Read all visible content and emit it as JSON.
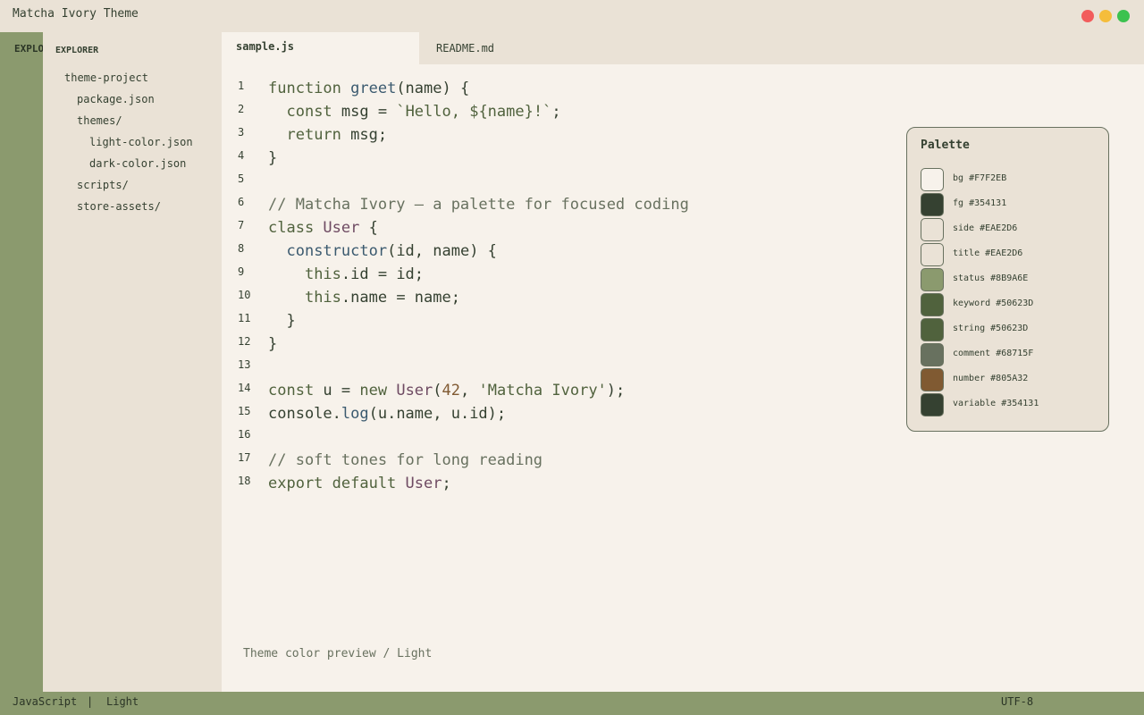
{
  "app": {
    "title": "Matcha Ivory Theme",
    "window_controls": [
      {
        "name": "close",
        "color": "#F25C5C"
      },
      {
        "name": "minimize",
        "color": "#F5BD3B"
      },
      {
        "name": "maximize",
        "color": "#3CC24F"
      }
    ]
  },
  "activity_bar": {
    "label": "EXPLORER"
  },
  "sidebar": {
    "header": "EXPLORER",
    "tree": [
      {
        "label": "theme-project",
        "depth": 0
      },
      {
        "label": "package.json",
        "depth": 1
      },
      {
        "label": "themes/",
        "depth": 1
      },
      {
        "label": "light-color.json",
        "depth": 2
      },
      {
        "label": "dark-color.json",
        "depth": 2
      },
      {
        "label": "scripts/",
        "depth": 1
      },
      {
        "label": "store-assets/",
        "depth": 1
      }
    ]
  },
  "tabs": [
    {
      "label": "sample.js",
      "active": true
    },
    {
      "label": "README.md",
      "active": false
    }
  ],
  "editor": {
    "lines": [
      [
        [
          "keyword",
          "function "
        ],
        [
          "fn",
          "greet"
        ],
        [
          "plain",
          "(name) {"
        ]
      ],
      [
        [
          "plain",
          "  "
        ],
        [
          "keyword",
          "const"
        ],
        [
          "plain",
          " msg = "
        ],
        [
          "string",
          "`Hello, ${name}!`"
        ],
        [
          "plain",
          ";"
        ]
      ],
      [
        [
          "plain",
          "  "
        ],
        [
          "keyword",
          "return"
        ],
        [
          "plain",
          " msg;"
        ]
      ],
      [
        [
          "plain",
          "}"
        ]
      ],
      [],
      [
        [
          "comment",
          "// Matcha Ivory — a palette for focused coding"
        ]
      ],
      [
        [
          "keyword",
          "class "
        ],
        [
          "class",
          "User"
        ],
        [
          "plain",
          " {"
        ]
      ],
      [
        [
          "plain",
          "  "
        ],
        [
          "fn",
          "constructor"
        ],
        [
          "plain",
          "(id, name) {"
        ]
      ],
      [
        [
          "plain",
          "    "
        ],
        [
          "keyword",
          "this"
        ],
        [
          "plain",
          ".id = id;"
        ]
      ],
      [
        [
          "plain",
          "    "
        ],
        [
          "keyword",
          "this"
        ],
        [
          "plain",
          ".name = name;"
        ]
      ],
      [
        [
          "plain",
          "  }"
        ]
      ],
      [
        [
          "plain",
          "}"
        ]
      ],
      [],
      [
        [
          "keyword",
          "const"
        ],
        [
          "plain",
          " u = "
        ],
        [
          "keyword",
          "new "
        ],
        [
          "class",
          "User"
        ],
        [
          "plain",
          "("
        ],
        [
          "number",
          "42"
        ],
        [
          "plain",
          ", "
        ],
        [
          "string",
          "'Matcha Ivory'"
        ],
        [
          "plain",
          ");"
        ]
      ],
      [
        [
          "plain",
          "console."
        ],
        [
          "fn",
          "log"
        ],
        [
          "plain",
          "(u.name, u.id);"
        ]
      ],
      [],
      [
        [
          "comment",
          "// soft tones for long reading"
        ]
      ],
      [
        [
          "keyword",
          "export default "
        ],
        [
          "class",
          "User"
        ],
        [
          "plain",
          ";"
        ]
      ]
    ],
    "footnote": "Theme color preview / Light"
  },
  "palette": {
    "title": "Palette",
    "entries": [
      {
        "name": "bg",
        "hex": "#F7F2EB"
      },
      {
        "name": "fg",
        "hex": "#354131"
      },
      {
        "name": "side",
        "hex": "#EAE2D6"
      },
      {
        "name": "title",
        "hex": "#EAE2D6"
      },
      {
        "name": "status",
        "hex": "#8B9A6E"
      },
      {
        "name": "keyword",
        "hex": "#50623D"
      },
      {
        "name": "string",
        "hex": "#50623D"
      },
      {
        "name": "comment",
        "hex": "#68715F"
      },
      {
        "name": "number",
        "hex": "#805A32"
      },
      {
        "name": "variable",
        "hex": "#354131"
      }
    ]
  },
  "status_bar": {
    "language": "JavaScript",
    "separator": "|",
    "theme": "Light",
    "encoding": "UTF-8"
  }
}
